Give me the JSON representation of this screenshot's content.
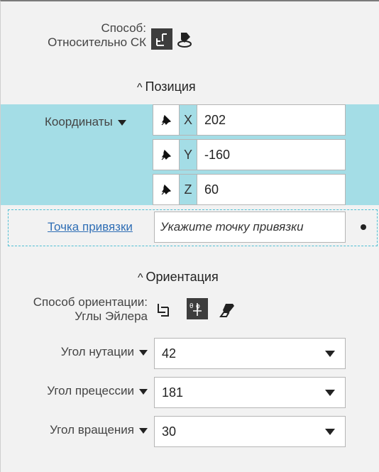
{
  "method": {
    "label": "Способ:",
    "value": "Относительно СК",
    "icons": [
      "axes-icon",
      "eraser-snap-icon"
    ]
  },
  "position": {
    "header": "Позиция",
    "coords_label": "Координаты",
    "rows": [
      {
        "axis": "X",
        "value": "202"
      },
      {
        "axis": "Y",
        "value": "-160"
      },
      {
        "axis": "Z",
        "value": "60"
      }
    ]
  },
  "snap": {
    "link": "Точка привязки",
    "placeholder": "Укажите точку привязки"
  },
  "orientation": {
    "header": "Ориентация",
    "mode_label": "Способ ориентации:",
    "mode_value": "Углы Эйлера",
    "icons": [
      "rotate-axes-icon",
      "euler-angles-icon",
      "eraser-icon"
    ],
    "fields": [
      {
        "label": "Угол нутации",
        "value": "42"
      },
      {
        "label": "Угол прецессии",
        "value": "181"
      },
      {
        "label": "Угол вращения",
        "value": "30"
      }
    ]
  }
}
